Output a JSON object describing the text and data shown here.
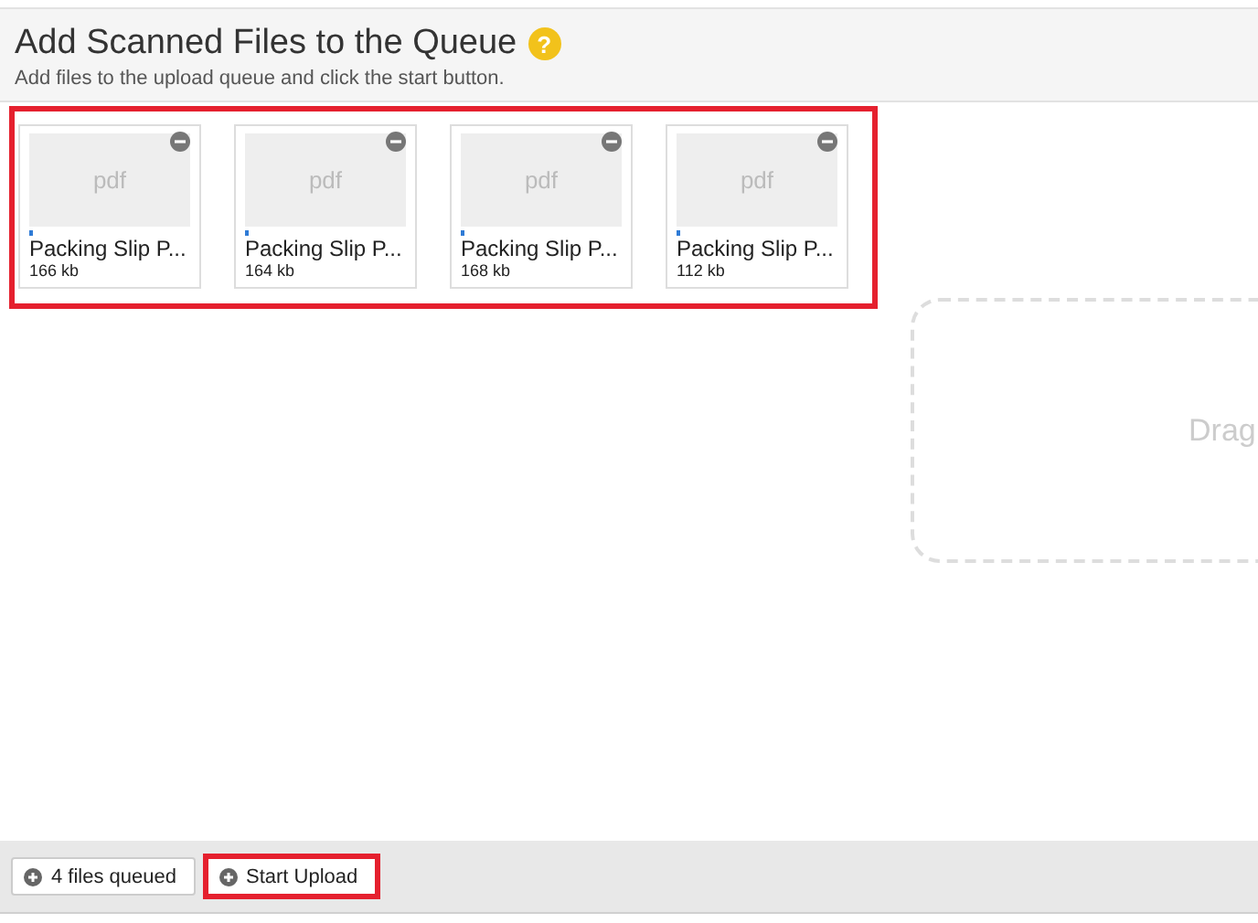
{
  "header": {
    "title": "Add Scanned Files to the Queue",
    "help_icon": "?",
    "subtitle": "Add files to the upload queue and click the start button."
  },
  "file_list": {
    "highlighted": true,
    "files": [
      {
        "thumbnail": "pdf",
        "name": "Packing Slip P...",
        "size": "166 kb",
        "level": 0.02
      },
      {
        "thumbnail": "pdf",
        "name": "Packing Slip P...",
        "size": "164 kb",
        "level": 0.02
      },
      {
        "thumbnail": "pdf",
        "name": "Packing Slip P...",
        "size": "168 kb",
        "level": 0.02
      },
      {
        "thumbnail": "pdf",
        "name": "Packing Slip P...",
        "size": "112 kb",
        "level": 0.02
      }
    ]
  },
  "drop_zone": {
    "text": "Drag"
  },
  "footer": {
    "buttons": [
      {
        "label": "4 files queued",
        "highlighted": false
      },
      {
        "label": "Start Upload",
        "highlighted": true
      }
    ]
  }
}
